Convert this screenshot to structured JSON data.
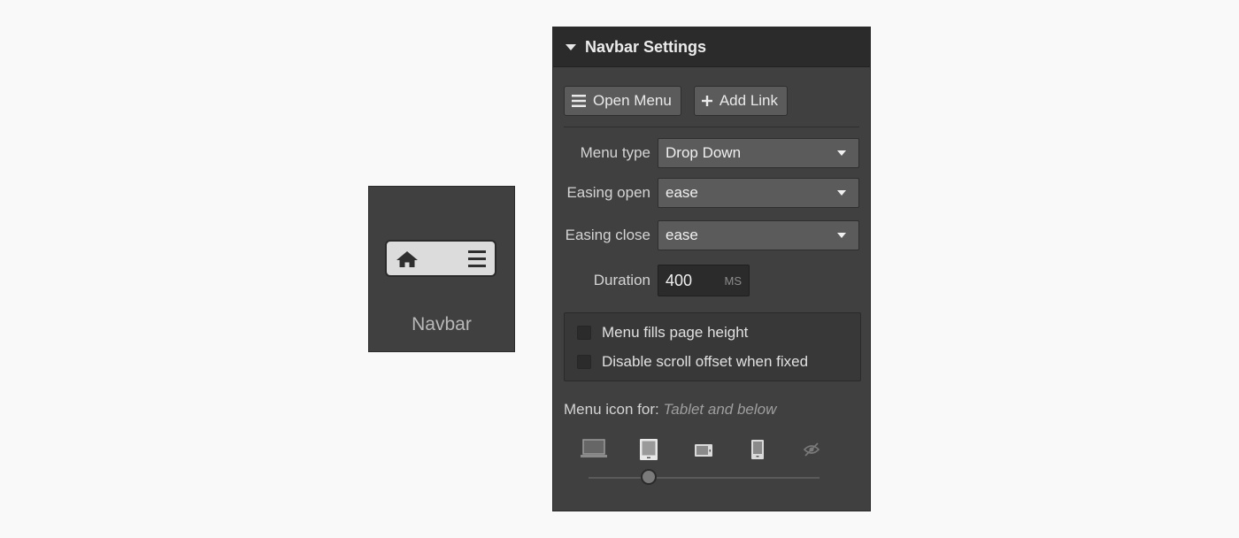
{
  "element_card": {
    "label": "Navbar",
    "icons": [
      "home-icon",
      "hamburger-icon"
    ]
  },
  "panel": {
    "title": "Navbar Settings",
    "buttons": {
      "open_menu": "Open Menu",
      "add_link": "Add Link"
    },
    "menu_type": {
      "label": "Menu type",
      "value": "Drop Down"
    },
    "easing_open": {
      "label": "Easing open",
      "value": "ease"
    },
    "easing_close": {
      "label": "Easing close",
      "value": "ease"
    },
    "duration": {
      "label": "Duration",
      "value": "400",
      "unit": "MS"
    },
    "checkboxes": [
      {
        "label": "Menu fills page height",
        "checked": false
      },
      {
        "label": "Disable scroll offset when fixed",
        "checked": false
      }
    ],
    "menu_icon_for": {
      "label": "Menu icon for:",
      "value": "Tablet and below"
    },
    "devices": [
      "desktop-icon",
      "tablet-icon",
      "mobile-landscape-icon",
      "mobile-portrait-icon",
      "hidden-icon"
    ],
    "selected_device_index": 1
  },
  "colors": {
    "panel_bg": "#404040",
    "header_bg": "#2b2b2b",
    "control_bg": "#5b5b5b",
    "page_bg": "#f9f9f9"
  }
}
